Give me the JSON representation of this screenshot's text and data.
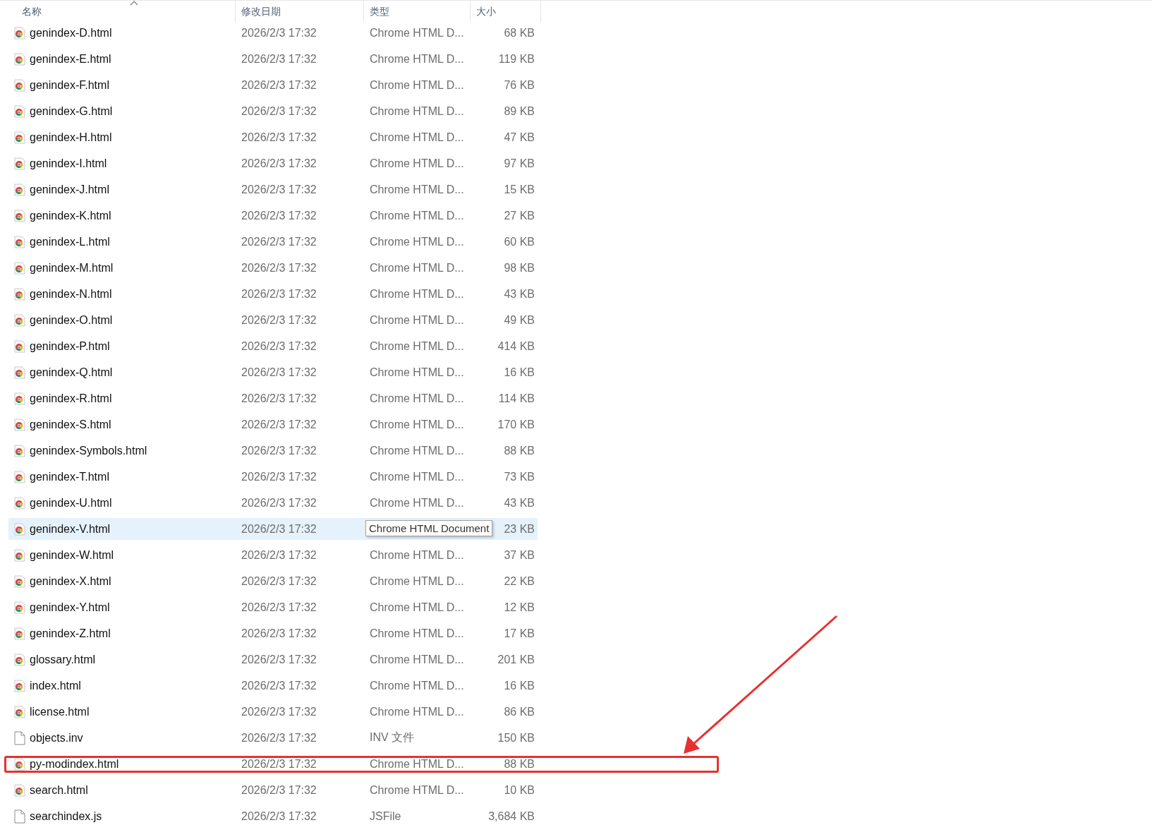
{
  "columns": [
    {
      "label": "名称",
      "sorted": true
    },
    {
      "label": "修改日期",
      "sorted": false
    },
    {
      "label": "类型",
      "sorted": false
    },
    {
      "label": "大小",
      "sorted": false
    }
  ],
  "rows": [
    {
      "kind": "chrome",
      "name": "genindex-D.html",
      "date": "2026/2/3 17:32",
      "type": "Chrome HTML D...",
      "size": "68 KB",
      "selected": false,
      "marked": false
    },
    {
      "kind": "chrome",
      "name": "genindex-E.html",
      "date": "2026/2/3 17:32",
      "type": "Chrome HTML D...",
      "size": "119 KB",
      "selected": false,
      "marked": false
    },
    {
      "kind": "chrome",
      "name": "genindex-F.html",
      "date": "2026/2/3 17:32",
      "type": "Chrome HTML D...",
      "size": "76 KB",
      "selected": false,
      "marked": false
    },
    {
      "kind": "chrome",
      "name": "genindex-G.html",
      "date": "2026/2/3 17:32",
      "type": "Chrome HTML D...",
      "size": "89 KB",
      "selected": false,
      "marked": false
    },
    {
      "kind": "chrome",
      "name": "genindex-H.html",
      "date": "2026/2/3 17:32",
      "type": "Chrome HTML D...",
      "size": "47 KB",
      "selected": false,
      "marked": false
    },
    {
      "kind": "chrome",
      "name": "genindex-I.html",
      "date": "2026/2/3 17:32",
      "type": "Chrome HTML D...",
      "size": "97 KB",
      "selected": false,
      "marked": false
    },
    {
      "kind": "chrome",
      "name": "genindex-J.html",
      "date": "2026/2/3 17:32",
      "type": "Chrome HTML D...",
      "size": "15 KB",
      "selected": false,
      "marked": false
    },
    {
      "kind": "chrome",
      "name": "genindex-K.html",
      "date": "2026/2/3 17:32",
      "type": "Chrome HTML D...",
      "size": "27 KB",
      "selected": false,
      "marked": false
    },
    {
      "kind": "chrome",
      "name": "genindex-L.html",
      "date": "2026/2/3 17:32",
      "type": "Chrome HTML D...",
      "size": "60 KB",
      "selected": false,
      "marked": false
    },
    {
      "kind": "chrome",
      "name": "genindex-M.html",
      "date": "2026/2/3 17:32",
      "type": "Chrome HTML D...",
      "size": "98 KB",
      "selected": false,
      "marked": false
    },
    {
      "kind": "chrome",
      "name": "genindex-N.html",
      "date": "2026/2/3 17:32",
      "type": "Chrome HTML D...",
      "size": "43 KB",
      "selected": false,
      "marked": false
    },
    {
      "kind": "chrome",
      "name": "genindex-O.html",
      "date": "2026/2/3 17:32",
      "type": "Chrome HTML D...",
      "size": "49 KB",
      "selected": false,
      "marked": false
    },
    {
      "kind": "chrome",
      "name": "genindex-P.html",
      "date": "2026/2/3 17:32",
      "type": "Chrome HTML D...",
      "size": "414 KB",
      "selected": false,
      "marked": false
    },
    {
      "kind": "chrome",
      "name": "genindex-Q.html",
      "date": "2026/2/3 17:32",
      "type": "Chrome HTML D...",
      "size": "16 KB",
      "selected": false,
      "marked": false
    },
    {
      "kind": "chrome",
      "name": "genindex-R.html",
      "date": "2026/2/3 17:32",
      "type": "Chrome HTML D...",
      "size": "114 KB",
      "selected": false,
      "marked": false
    },
    {
      "kind": "chrome",
      "name": "genindex-S.html",
      "date": "2026/2/3 17:32",
      "type": "Chrome HTML D...",
      "size": "170 KB",
      "selected": false,
      "marked": false
    },
    {
      "kind": "chrome",
      "name": "genindex-Symbols.html",
      "date": "2026/2/3 17:32",
      "type": "Chrome HTML D...",
      "size": "88 KB",
      "selected": false,
      "marked": false
    },
    {
      "kind": "chrome",
      "name": "genindex-T.html",
      "date": "2026/2/3 17:32",
      "type": "Chrome HTML D...",
      "size": "73 KB",
      "selected": false,
      "marked": false
    },
    {
      "kind": "chrome",
      "name": "genindex-U.html",
      "date": "2026/2/3 17:32",
      "type": "Chrome HTML D...",
      "size": "43 KB",
      "selected": false,
      "marked": false
    },
    {
      "kind": "chrome",
      "name": "genindex-V.html",
      "date": "2026/2/3 17:32",
      "tooltip": "Chrome HTML Document",
      "size": "23 KB",
      "selected": true,
      "marked": false
    },
    {
      "kind": "chrome",
      "name": "genindex-W.html",
      "date": "2026/2/3 17:32",
      "type": "Chrome HTML D...",
      "size": "37 KB",
      "selected": false,
      "marked": false
    },
    {
      "kind": "chrome",
      "name": "genindex-X.html",
      "date": "2026/2/3 17:32",
      "type": "Chrome HTML D...",
      "size": "22 KB",
      "selected": false,
      "marked": false
    },
    {
      "kind": "chrome",
      "name": "genindex-Y.html",
      "date": "2026/2/3 17:32",
      "type": "Chrome HTML D...",
      "size": "12 KB",
      "selected": false,
      "marked": false
    },
    {
      "kind": "chrome",
      "name": "genindex-Z.html",
      "date": "2026/2/3 17:32",
      "type": "Chrome HTML D...",
      "size": "17 KB",
      "selected": false,
      "marked": false
    },
    {
      "kind": "chrome",
      "name": "glossary.html",
      "date": "2026/2/3 17:32",
      "type": "Chrome HTML D...",
      "size": "201 KB",
      "selected": false,
      "marked": false
    },
    {
      "kind": "chrome",
      "name": "index.html",
      "date": "2026/2/3 17:32",
      "type": "Chrome HTML D...",
      "size": "16 KB",
      "selected": false,
      "marked": false
    },
    {
      "kind": "chrome",
      "name": "license.html",
      "date": "2026/2/3 17:32",
      "type": "Chrome HTML D...",
      "size": "86 KB",
      "selected": false,
      "marked": false
    },
    {
      "kind": "file",
      "name": "objects.inv",
      "date": "2026/2/3 17:32",
      "type": "INV 文件",
      "size": "150 KB",
      "selected": false,
      "marked": false
    },
    {
      "kind": "chrome",
      "name": "py-modindex.html",
      "date": "2026/2/3 17:32",
      "type": "Chrome HTML D...",
      "size": "88 KB",
      "selected": false,
      "marked": true
    },
    {
      "kind": "chrome",
      "name": "search.html",
      "date": "2026/2/3 17:32",
      "type": "Chrome HTML D...",
      "size": "10 KB",
      "selected": false,
      "marked": false
    },
    {
      "kind": "file",
      "name": "searchindex.js",
      "date": "2026/2/3 17:32",
      "type": "JSFile",
      "size": "3,684 KB",
      "selected": false,
      "marked": false
    }
  ]
}
